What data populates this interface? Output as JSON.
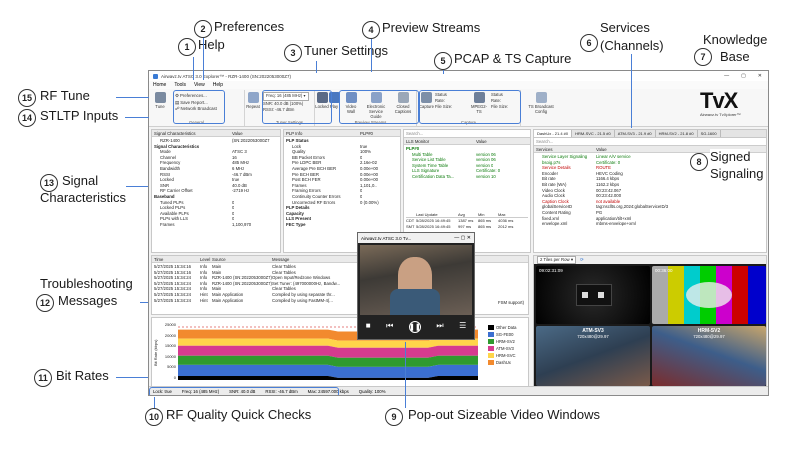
{
  "app": {
    "title": "Airwavz.tv ATSC 3.0 Explorer™ - RZR-1400 (SN:2022053000Z7)",
    "menu": [
      "Home",
      "Tools",
      "View",
      "Help"
    ],
    "ribbon": {
      "tune": "Tune",
      "preferences": "Preferences...",
      "save_report": "Save Report...",
      "network_broadcast": "Network Broadcast",
      "general": "General",
      "repeat": "Repeat",
      "freq": "Freq: 16 (485 MHz)",
      "snr": "SNR: 40.0 dB (100%)",
      "rssi": "RSSI: -46.7 dBm",
      "locked": "Locked",
      "tuner_settings": "Tuner Settings",
      "play": "Play",
      "video_wall": "Video Wall",
      "esg": "Electronic Service Guide",
      "closed_captions": "Closed Captions",
      "preview_streams": "Preview Streams",
      "capture": "Capture",
      "status": "Status",
      "rate": "Rate:",
      "file_size": "File Size:",
      "mpeg_ts": "MPEG2-TS",
      "capture_group": "Capture",
      "ts_broadcast": "TS Broadcast Config"
    },
    "signal": {
      "headers": [
        "Signal Characteristics",
        "Value"
      ],
      "rows": [
        [
          "RZR-1400",
          "(SN:2022053000Z7"
        ],
        [
          "Signal Characteristics",
          ""
        ],
        [
          "Mode",
          "ATSC 3"
        ],
        [
          "Channel",
          "16"
        ],
        [
          "Frequency",
          "485 MHz"
        ],
        [
          "Bandwidth",
          "6 MHz"
        ],
        [
          "RSSI",
          "-46.7 dBm"
        ],
        [
          "Locked",
          "true"
        ],
        [
          "SNR",
          "40.0 dB"
        ],
        [
          "RF Carrier Offset",
          "-2719 Hz"
        ],
        [
          "Baseband",
          ""
        ],
        [
          "Tuned PLPs",
          "0"
        ],
        [
          "Locked PLPs",
          "0"
        ],
        [
          "Available PLPs",
          "0"
        ],
        [
          "PLPs with LLS",
          "0"
        ],
        [
          "Frames",
          "1,100,970"
        ]
      ]
    },
    "plp": {
      "headers": [
        "PLP Info",
        "PLP#0"
      ],
      "rows": [
        [
          "PLP Status",
          ""
        ],
        [
          "Lock",
          "true"
        ],
        [
          "Quality",
          "100%"
        ],
        [
          "BB Packet Errors",
          "0"
        ],
        [
          "Pre LDPC BER",
          "2.16e-02"
        ],
        [
          "Average Pre BCH BER",
          "0.00e+00"
        ],
        [
          "Pre BCH BER",
          "0.00e+00"
        ],
        [
          "Post BCH FER",
          "0.00e+00"
        ],
        [
          "Frames",
          "1,101,0.."
        ],
        [
          "Framing Errors",
          "0"
        ],
        [
          "Continuity Counter Errors",
          "0"
        ],
        [
          "Uncorrected RF Errors",
          "0 (0.00%)"
        ],
        [
          "PLP Details",
          ""
        ],
        [
          "Capacity",
          ""
        ],
        [
          "LLS Present",
          ""
        ],
        [
          "FEC Type",
          ""
        ]
      ]
    },
    "lls": {
      "search": "Search...",
      "headers": [
        "LLS Monitor",
        "Value"
      ],
      "rows": [
        [
          "PLP#0",
          ""
        ],
        [
          "Multi Table",
          "version 06"
        ],
        [
          "Service List Table",
          "version 06"
        ],
        [
          "System Time Table",
          "version 0"
        ],
        [
          "LLS Signature",
          "Certificate: 0"
        ],
        [
          "Certification Data Ta...",
          "version 10"
        ]
      ],
      "table_headers": [
        "",
        "Last Update",
        "Avg",
        "Min",
        "Max"
      ],
      "table_rows": [
        [
          "CDT",
          "5/28/2025 16:49:45",
          "1387 ms",
          "865 ms",
          "4036 ms"
        ],
        [
          "SMT",
          "5/28/2025 16:49:45",
          "997 ms",
          "865 ms",
          "2012 ms"
        ]
      ]
    },
    "services": {
      "tabs": [
        "DashUx - 21.4 #0",
        "HRM-SVC - 21.5 #0",
        "ATM-SV3 - 21.9 #0",
        "HRM-SV2 - 21.8 #0",
        "SG-1600"
      ],
      "search": "Search...",
      "headers": [
        "Services",
        "Value"
      ],
      "rows": [
        [
          "Service Layer Signaling",
          "Linear A/V service"
        ],
        [
          "bsoig.p7s",
          "Certificate: 0"
        ],
        [
          "Service Details",
          "ROUTE"
        ],
        [
          "Encoder",
          "HEVC Coding"
        ],
        [
          "Bit rate",
          "1166.4 kbps"
        ],
        [
          "Bit rate (WA)",
          "1162.2 kbps"
        ],
        [
          "Video Clock",
          "00:23:42.067"
        ],
        [
          "Audio Clock",
          "00:23:42.000"
        ],
        [
          "Caption Clock",
          "not available"
        ],
        [
          "globalServiceID",
          "tag:nscllts.org,2024:globalServiceID/3"
        ],
        [
          "Content Rating",
          "PG"
        ],
        [
          "fixed.xml",
          "application/tilt+xml"
        ],
        [
          "envelope.xml",
          "mbms-envelope+xml"
        ]
      ]
    },
    "log": {
      "headers": [
        "Time",
        "Level",
        "Source",
        "Message"
      ],
      "rows": [
        [
          "5/27/2025 15:34:16",
          "Info",
          "Main",
          "Clear Tables"
        ],
        [
          "5/27/2025 15:34:16",
          "Info",
          "Main",
          "Clear Tables"
        ],
        [
          "5/27/2025 15:34:24",
          "Info",
          "RZR-1400 (SN:2022053000Z7)",
          "Open Input/Redzone Windows"
        ],
        [
          "5/27/2025 15:34:24",
          "Info",
          "RZR-1400 (SN:2022053000Z7)",
          "Set Tuner: (497000000Hz, Bandw..."
        ],
        [
          "5/27/2025 15:34:24",
          "Info",
          "Main",
          "Clear Tables"
        ],
        [
          "5/27/2025 15:34:24",
          "Hint",
          "Main Application",
          "Compiled by using separate thr..."
        ],
        [
          "5/27/2025 15:34:24",
          "Hint",
          "Main Application",
          "Compiled by using FastMM-4(..."
        ]
      ],
      "tail": "FSM support)"
    },
    "bitrate": {
      "ylabel": "Bit Rate (kbps)",
      "ticks": [
        "25000",
        "20000",
        "15000",
        "10000",
        "5000",
        "0"
      ],
      "legend": [
        "Other Data",
        "SG-FE00",
        "HRM-SV2",
        "ATM-SV3",
        "HRM-SVC",
        "DashUx"
      ],
      "colors": [
        "#000000",
        "#3b6fd1",
        "#2f9a2f",
        "#d63b8f",
        "#ffd54a",
        "#f28a2e"
      ]
    },
    "status": {
      "lock": "Lock: true",
      "freq": "Freq: 16 (485 MHz)",
      "snr": "SNR: 40.0 dB",
      "rssi": "RSSI: -46.7 dBm",
      "max": "Max: 24597.000 kbps",
      "quality": "Quality: 100%"
    },
    "popout": {
      "title": "Airwavz.tv ATSC 3.0 Tv..."
    },
    "tiles": {
      "selector": "2 Tiles per Row",
      "labels": [
        "ATM-SV3",
        "HRM-SV2"
      ],
      "sizes": [
        "720x480@29.97",
        "720x480@29.97"
      ],
      "times": [
        "09:02:31:09",
        "00:36:00"
      ]
    }
  },
  "brand": {
    "logo": "TvX",
    "tagline": "Airwavz.tv TvXplorer™"
  },
  "callouts": [
    {
      "n": "1",
      "label": "Help"
    },
    {
      "n": "2",
      "label": "Preferences"
    },
    {
      "n": "3",
      "label": "Tuner Settings"
    },
    {
      "n": "4",
      "label": "Preview Streams"
    },
    {
      "n": "5",
      "label": "PCAP & TS Capture"
    },
    {
      "n": "6",
      "label": "Services"
    },
    {
      "n": "6b",
      "label": "(Channels)"
    },
    {
      "n": "7",
      "label": "Knowledge"
    },
    {
      "n": "7b",
      "label": "Base"
    },
    {
      "n": "8",
      "label": "Signed"
    },
    {
      "n": "8b",
      "label": "Signaling"
    },
    {
      "n": "9",
      "label": "Pop-out Sizeable Video Windows"
    },
    {
      "n": "10",
      "label": "RF Quality Quick Checks"
    },
    {
      "n": "11",
      "label": "Bit Rates"
    },
    {
      "n": "12",
      "label": "Troubleshooting"
    },
    {
      "n": "12b",
      "label": "Messages"
    },
    {
      "n": "13",
      "label": "Signal"
    },
    {
      "n": "13b",
      "label": "Characteristics"
    },
    {
      "n": "14",
      "label": "STLTP Inputs"
    },
    {
      "n": "15",
      "label": "RF Tune"
    }
  ]
}
